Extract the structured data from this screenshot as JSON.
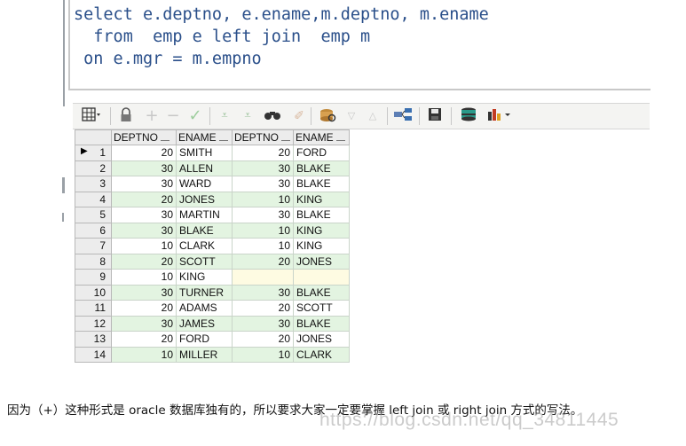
{
  "sql": {
    "line1": "select e.deptno, e.ename,m.deptno, m.ename",
    "line2": "  from  emp e left join  emp m",
    "line3": " on e.mgr = m.empno"
  },
  "toolbar": {
    "items": [
      "grid-icon",
      "lock-icon",
      "add-icon",
      "remove-icon",
      "post-icon",
      "filter-down-icon",
      "filter-down2-icon",
      "find-icon",
      "clear-icon",
      "query-icon",
      "next-down-icon",
      "prev-up-icon",
      "connect-icon",
      "save-icon",
      "export-icon",
      "chart-icon"
    ]
  },
  "grid": {
    "columns": [
      "DEPTNO",
      "ENAME",
      "DEPTNO",
      "ENAME"
    ],
    "rows": [
      [
        "1",
        "20",
        "SMITH",
        "20",
        "FORD"
      ],
      [
        "2",
        "30",
        "ALLEN",
        "30",
        "BLAKE"
      ],
      [
        "3",
        "30",
        "WARD",
        "30",
        "BLAKE"
      ],
      [
        "4",
        "20",
        "JONES",
        "10",
        "KING"
      ],
      [
        "5",
        "30",
        "MARTIN",
        "30",
        "BLAKE"
      ],
      [
        "6",
        "30",
        "BLAKE",
        "10",
        "KING"
      ],
      [
        "7",
        "10",
        "CLARK",
        "10",
        "KING"
      ],
      [
        "8",
        "20",
        "SCOTT",
        "20",
        "JONES"
      ],
      [
        "9",
        "10",
        "KING",
        "",
        ""
      ],
      [
        "10",
        "30",
        "TURNER",
        "30",
        "BLAKE"
      ],
      [
        "11",
        "20",
        "ADAMS",
        "20",
        "SCOTT"
      ],
      [
        "12",
        "30",
        "JAMES",
        "30",
        "BLAKE"
      ],
      [
        "13",
        "20",
        "FORD",
        "20",
        "JONES"
      ],
      [
        "14",
        "10",
        "MILLER",
        "10",
        "CLARK"
      ]
    ]
  },
  "caption": "因为（+）这种形式是 oracle 数据库独有的，所以要求大家一定要掌握 left join 或 right join 方式的写法。",
  "watermark": "https://blog.csdn.net/qq_34811445",
  "colors": {
    "sql_text": "#2a4f8a",
    "row_alt": "#e3f4e1",
    "null_cell": "#fefbe2"
  }
}
